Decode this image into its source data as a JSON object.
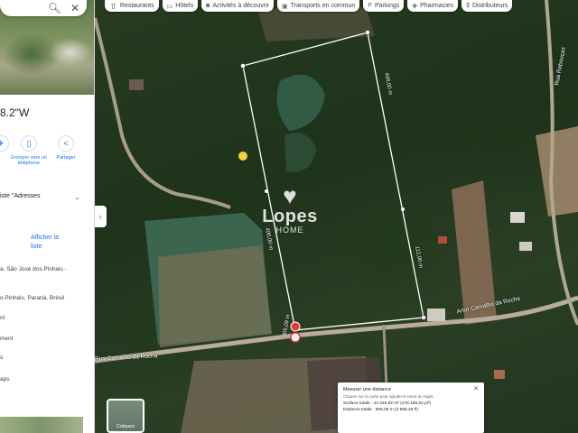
{
  "panel": {
    "search_icon": "search-icon",
    "close_icon": "close-icon",
    "coords": "8.2\"W",
    "actions": [
      {
        "icon": "plane-icon",
        "label": ""
      },
      {
        "icon": "phone-icon",
        "label": "Envoyer vers un téléphone"
      },
      {
        "icon": "share-icon",
        "label": "Partager"
      }
    ],
    "list_label": "iste \"Adresses",
    "show_list": "Afficher la liste",
    "address_lines": [
      "a, São José dos Pinhais -",
      "",
      "o Pinhais, Paraná, Brésil",
      "nt",
      "",
      "ment",
      "",
      "s",
      "",
      "aps"
    ]
  },
  "chips": [
    {
      "icon": "restaurant-icon",
      "label": "Restaurants"
    },
    {
      "icon": "hotel-icon",
      "label": "Hôtels"
    },
    {
      "icon": "camera-icon",
      "label": "Activités à découvrir"
    },
    {
      "icon": "bus-icon",
      "label": "Transports en commun"
    },
    {
      "icon": "parking-icon",
      "label": "Parkings"
    },
    {
      "icon": "pharmacy-icon",
      "label": "Pharmacies"
    },
    {
      "icon": "atm-icon",
      "label": "Distributeurs"
    }
  ],
  "map": {
    "road_main": "Rua Carvalho da Rocha",
    "road_main_2": "Artur Carvalho da Rocha",
    "road_side": "Rua Rebouças",
    "dist_right": "400,00 m",
    "dist_left": "400,00 m",
    "dist_inner": "112,00 m",
    "dist_bottom": "905,09 m"
  },
  "watermark": {
    "brand": "Lopes",
    "sub": "HOME"
  },
  "measure": {
    "title": "Mesurer une distance",
    "hint": "Cliquez sur la carte pour ajouter le tracé au trajet.",
    "area": "Surface totale : 44 425,82 m² (478 195,52 pi²)",
    "distance": "Distance totale : 905,09 m (2 969,46 ft)"
  },
  "layers": {
    "label": "Calques"
  },
  "colors": {
    "measure_line": "#ffffff",
    "marker": "#e53935",
    "accent": "#1a73e8"
  }
}
